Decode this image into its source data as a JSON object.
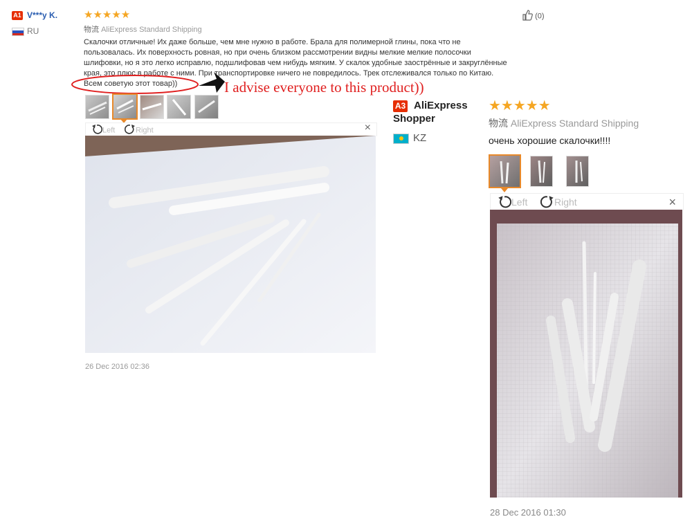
{
  "review1": {
    "badge": "A1",
    "name": "V***y K.",
    "country": "RU",
    "stars": "★★★★★",
    "shipping_prefix": "物流",
    "shipping": "AliExpress Standard Shipping",
    "likes": "(0)",
    "text_lines": [
      "Скалочки отличные! Их даже больше, чем мне нужно в работе. Брала для полимерной глины, пока что не",
      "пользовалась. Их поверхность ровная, но при очень близком рассмотрении видны мелкие мелкие полосочки",
      "шлифовки, но я это легко исправлю, подшлифовав чем нибудь мягким. У скалок удобные заострённые и закруглённые",
      "края, это плюс в работе с ними. При транспортировке ничего не повредилось. Трек отслеживался только по Китаю."
    ],
    "highlight": "Всем советую этот товар))",
    "annotation": "I advise everyone to this product))",
    "rotate_left": "Left",
    "rotate_right": "Right",
    "close": "×",
    "date": "26 Dec 2016 02:36"
  },
  "review2": {
    "badge": "A3",
    "name_line1": "AliExpress",
    "name_line2": "Shopper",
    "country": "KZ",
    "stars": "★★★★★",
    "shipping_prefix": "物流",
    "shipping": "AliExpress Standard Shipping",
    "text": "очень хорошие скалочки!!!!",
    "rotate_left": "Left",
    "rotate_right": "Right",
    "close": "×",
    "date": "28 Dec 2016 01:30"
  },
  "colors": {
    "badge": "#e62e04",
    "name": "#2a5db0",
    "stars": "#f5a623",
    "annotation": "#e02020",
    "active_thumb": "#e8892a"
  }
}
